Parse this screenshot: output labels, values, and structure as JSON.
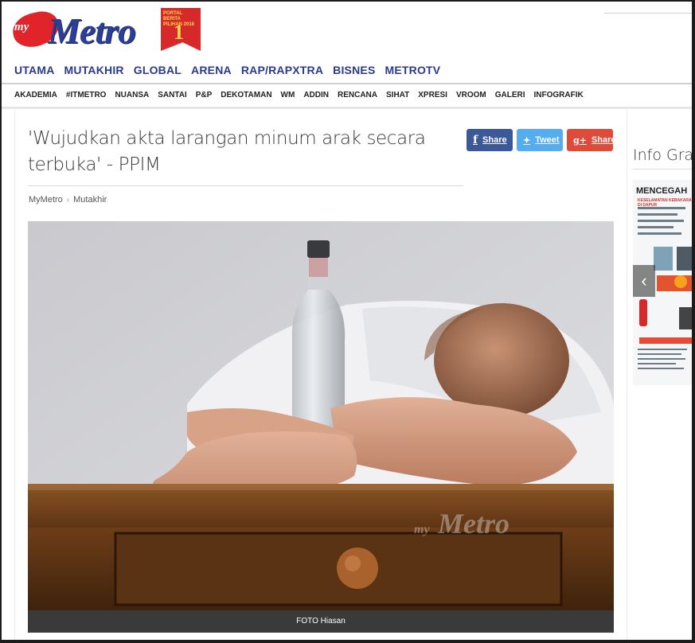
{
  "brand": {
    "logo_my": "my",
    "logo_word": "Metro",
    "badge_text": "PORTAL BERITA PILIHAN 2018",
    "badge_number": "NO 1"
  },
  "nav_primary": [
    "UTAMA",
    "MUTAKHIR",
    "GLOBAL",
    "ARENA",
    "RAP/RAPXTRA",
    "BISNES",
    "METROTV"
  ],
  "nav_secondary": [
    "AKADEMIA",
    "#ITMETRO",
    "NUANSA",
    "SANTAI",
    "P&P",
    "DEKOTAMAN",
    "WM",
    "ADDIN",
    "RENCANA",
    "SIHAT",
    "XPRESI",
    "VROOM",
    "GALERI",
    "INFOGRAFIK"
  ],
  "article": {
    "title": "'Wujudkan akta larangan minum arak secara terbuka' - PPIM",
    "breadcrumb": [
      "MyMetro",
      "Mutakhir"
    ],
    "image_caption": "FOTO Hiasan",
    "watermark_my": "my",
    "watermark_word": "Metro"
  },
  "share": {
    "facebook_icon": "f",
    "facebook_label": "Share",
    "twitter_icon": "🐦",
    "twitter_label": "Tweet",
    "google_icon": "g+",
    "google_label": "Share"
  },
  "sidebar": {
    "title": "Info Grafik",
    "infographic_head": "MENCEGAH",
    "infographic_sub": "KESELAMATAN KEBAKARAN DI DAPUR",
    "arrow": "‹"
  },
  "colors": {
    "brand_blue": "#2b3a8c",
    "brand_red": "#e0242a",
    "facebook": "#3b5998",
    "twitter": "#55acee",
    "google": "#dd4b39"
  }
}
